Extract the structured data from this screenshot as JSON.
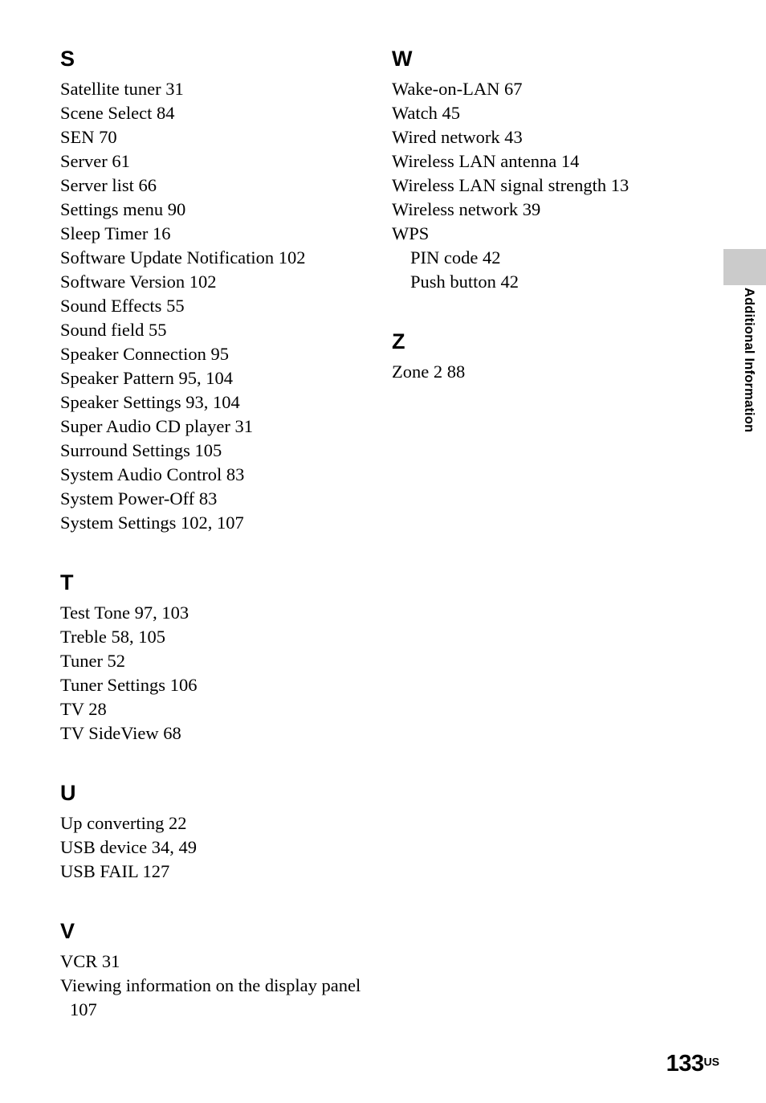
{
  "document": {
    "page_number": "133",
    "page_region_suffix": "US",
    "edge_tab_label": "Additional Information"
  },
  "columns": {
    "left": [
      {
        "heading": "S",
        "entries": [
          {
            "text": "Satellite tuner 31",
            "style": "normal"
          },
          {
            "text": "Scene Select 84",
            "style": "normal"
          },
          {
            "text": "SEN 70",
            "style": "normal"
          },
          {
            "text": "Server 61",
            "style": "normal"
          },
          {
            "text": "Server list 66",
            "style": "normal"
          },
          {
            "text": "Settings menu 90",
            "style": "normal"
          },
          {
            "text": "Sleep Timer 16",
            "style": "normal"
          },
          {
            "text": "Software Update Notification 102",
            "style": "normal"
          },
          {
            "text": "Software Version 102",
            "style": "normal"
          },
          {
            "text": "Sound Effects 55",
            "style": "normal"
          },
          {
            "text": "Sound field 55",
            "style": "normal"
          },
          {
            "text": "Speaker Connection 95",
            "style": "normal"
          },
          {
            "text": "Speaker Pattern 95, 104",
            "style": "normal"
          },
          {
            "text": "Speaker Settings 93, 104",
            "style": "normal"
          },
          {
            "text": "Super Audio CD player 31",
            "style": "normal"
          },
          {
            "text": "Surround Settings 105",
            "style": "normal"
          },
          {
            "text": "System Audio Control 83",
            "style": "normal"
          },
          {
            "text": "System Power-Off 83",
            "style": "normal"
          },
          {
            "text": "System Settings 102, 107",
            "style": "normal"
          }
        ]
      },
      {
        "heading": "T",
        "entries": [
          {
            "text": "Test Tone 97, 103",
            "style": "normal"
          },
          {
            "text": "Treble 58, 105",
            "style": "normal"
          },
          {
            "text": "Tuner 52",
            "style": "normal"
          },
          {
            "text": "Tuner Settings 106",
            "style": "normal"
          },
          {
            "text": "TV 28",
            "style": "normal"
          },
          {
            "text": "TV SideView 68",
            "style": "normal"
          }
        ]
      },
      {
        "heading": "U",
        "entries": [
          {
            "text": "Up converting 22",
            "style": "normal"
          },
          {
            "text": "USB device 34, 49",
            "style": "normal"
          },
          {
            "text": "USB FAIL 127",
            "style": "normal"
          }
        ]
      },
      {
        "heading": "V",
        "entries": [
          {
            "text": "VCR 31",
            "style": "normal"
          },
          {
            "text": "Viewing information on the display panel 107",
            "style": "wrap"
          }
        ]
      }
    ],
    "right": [
      {
        "heading": "W",
        "entries": [
          {
            "text": "Wake-on-LAN 67",
            "style": "normal"
          },
          {
            "text": "Watch 45",
            "style": "normal"
          },
          {
            "text": "Wired network 43",
            "style": "normal"
          },
          {
            "text": "Wireless LAN antenna 14",
            "style": "normal"
          },
          {
            "text": "Wireless LAN signal strength 13",
            "style": "normal"
          },
          {
            "text": "Wireless network 39",
            "style": "normal"
          },
          {
            "text": "WPS",
            "style": "normal"
          },
          {
            "text": "PIN code 42",
            "style": "sub"
          },
          {
            "text": "Push button 42",
            "style": "sub"
          }
        ]
      },
      {
        "heading": "Z",
        "entries": [
          {
            "text": "Zone 2 88",
            "style": "normal"
          }
        ]
      }
    ]
  },
  "colors": {
    "page_background": "#ffffff",
    "text": "#000000",
    "edge_tab": "#cbcbcb"
  }
}
